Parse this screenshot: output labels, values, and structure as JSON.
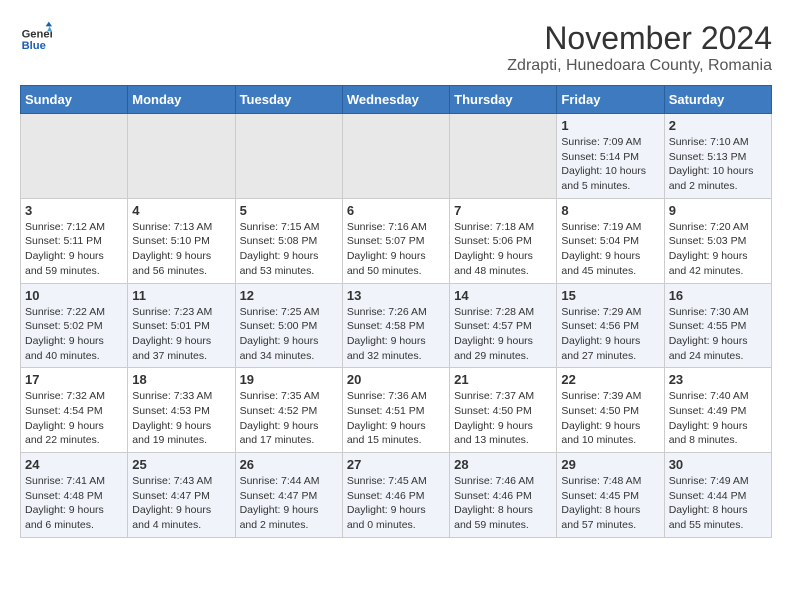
{
  "header": {
    "logo_line1": "General",
    "logo_line2": "Blue",
    "month": "November 2024",
    "location": "Zdrapti, Hunedoara County, Romania"
  },
  "weekdays": [
    "Sunday",
    "Monday",
    "Tuesday",
    "Wednesday",
    "Thursday",
    "Friday",
    "Saturday"
  ],
  "weeks": [
    [
      {
        "day": "",
        "info": ""
      },
      {
        "day": "",
        "info": ""
      },
      {
        "day": "",
        "info": ""
      },
      {
        "day": "",
        "info": ""
      },
      {
        "day": "",
        "info": ""
      },
      {
        "day": "1",
        "info": "Sunrise: 7:09 AM\nSunset: 5:14 PM\nDaylight: 10 hours and 5 minutes."
      },
      {
        "day": "2",
        "info": "Sunrise: 7:10 AM\nSunset: 5:13 PM\nDaylight: 10 hours and 2 minutes."
      }
    ],
    [
      {
        "day": "3",
        "info": "Sunrise: 7:12 AM\nSunset: 5:11 PM\nDaylight: 9 hours and 59 minutes."
      },
      {
        "day": "4",
        "info": "Sunrise: 7:13 AM\nSunset: 5:10 PM\nDaylight: 9 hours and 56 minutes."
      },
      {
        "day": "5",
        "info": "Sunrise: 7:15 AM\nSunset: 5:08 PM\nDaylight: 9 hours and 53 minutes."
      },
      {
        "day": "6",
        "info": "Sunrise: 7:16 AM\nSunset: 5:07 PM\nDaylight: 9 hours and 50 minutes."
      },
      {
        "day": "7",
        "info": "Sunrise: 7:18 AM\nSunset: 5:06 PM\nDaylight: 9 hours and 48 minutes."
      },
      {
        "day": "8",
        "info": "Sunrise: 7:19 AM\nSunset: 5:04 PM\nDaylight: 9 hours and 45 minutes."
      },
      {
        "day": "9",
        "info": "Sunrise: 7:20 AM\nSunset: 5:03 PM\nDaylight: 9 hours and 42 minutes."
      }
    ],
    [
      {
        "day": "10",
        "info": "Sunrise: 7:22 AM\nSunset: 5:02 PM\nDaylight: 9 hours and 40 minutes."
      },
      {
        "day": "11",
        "info": "Sunrise: 7:23 AM\nSunset: 5:01 PM\nDaylight: 9 hours and 37 minutes."
      },
      {
        "day": "12",
        "info": "Sunrise: 7:25 AM\nSunset: 5:00 PM\nDaylight: 9 hours and 34 minutes."
      },
      {
        "day": "13",
        "info": "Sunrise: 7:26 AM\nSunset: 4:58 PM\nDaylight: 9 hours and 32 minutes."
      },
      {
        "day": "14",
        "info": "Sunrise: 7:28 AM\nSunset: 4:57 PM\nDaylight: 9 hours and 29 minutes."
      },
      {
        "day": "15",
        "info": "Sunrise: 7:29 AM\nSunset: 4:56 PM\nDaylight: 9 hours and 27 minutes."
      },
      {
        "day": "16",
        "info": "Sunrise: 7:30 AM\nSunset: 4:55 PM\nDaylight: 9 hours and 24 minutes."
      }
    ],
    [
      {
        "day": "17",
        "info": "Sunrise: 7:32 AM\nSunset: 4:54 PM\nDaylight: 9 hours and 22 minutes."
      },
      {
        "day": "18",
        "info": "Sunrise: 7:33 AM\nSunset: 4:53 PM\nDaylight: 9 hours and 19 minutes."
      },
      {
        "day": "19",
        "info": "Sunrise: 7:35 AM\nSunset: 4:52 PM\nDaylight: 9 hours and 17 minutes."
      },
      {
        "day": "20",
        "info": "Sunrise: 7:36 AM\nSunset: 4:51 PM\nDaylight: 9 hours and 15 minutes."
      },
      {
        "day": "21",
        "info": "Sunrise: 7:37 AM\nSunset: 4:50 PM\nDaylight: 9 hours and 13 minutes."
      },
      {
        "day": "22",
        "info": "Sunrise: 7:39 AM\nSunset: 4:50 PM\nDaylight: 9 hours and 10 minutes."
      },
      {
        "day": "23",
        "info": "Sunrise: 7:40 AM\nSunset: 4:49 PM\nDaylight: 9 hours and 8 minutes."
      }
    ],
    [
      {
        "day": "24",
        "info": "Sunrise: 7:41 AM\nSunset: 4:48 PM\nDaylight: 9 hours and 6 minutes."
      },
      {
        "day": "25",
        "info": "Sunrise: 7:43 AM\nSunset: 4:47 PM\nDaylight: 9 hours and 4 minutes."
      },
      {
        "day": "26",
        "info": "Sunrise: 7:44 AM\nSunset: 4:47 PM\nDaylight: 9 hours and 2 minutes."
      },
      {
        "day": "27",
        "info": "Sunrise: 7:45 AM\nSunset: 4:46 PM\nDaylight: 9 hours and 0 minutes."
      },
      {
        "day": "28",
        "info": "Sunrise: 7:46 AM\nSunset: 4:46 PM\nDaylight: 8 hours and 59 minutes."
      },
      {
        "day": "29",
        "info": "Sunrise: 7:48 AM\nSunset: 4:45 PM\nDaylight: 8 hours and 57 minutes."
      },
      {
        "day": "30",
        "info": "Sunrise: 7:49 AM\nSunset: 4:44 PM\nDaylight: 8 hours and 55 minutes."
      }
    ]
  ]
}
